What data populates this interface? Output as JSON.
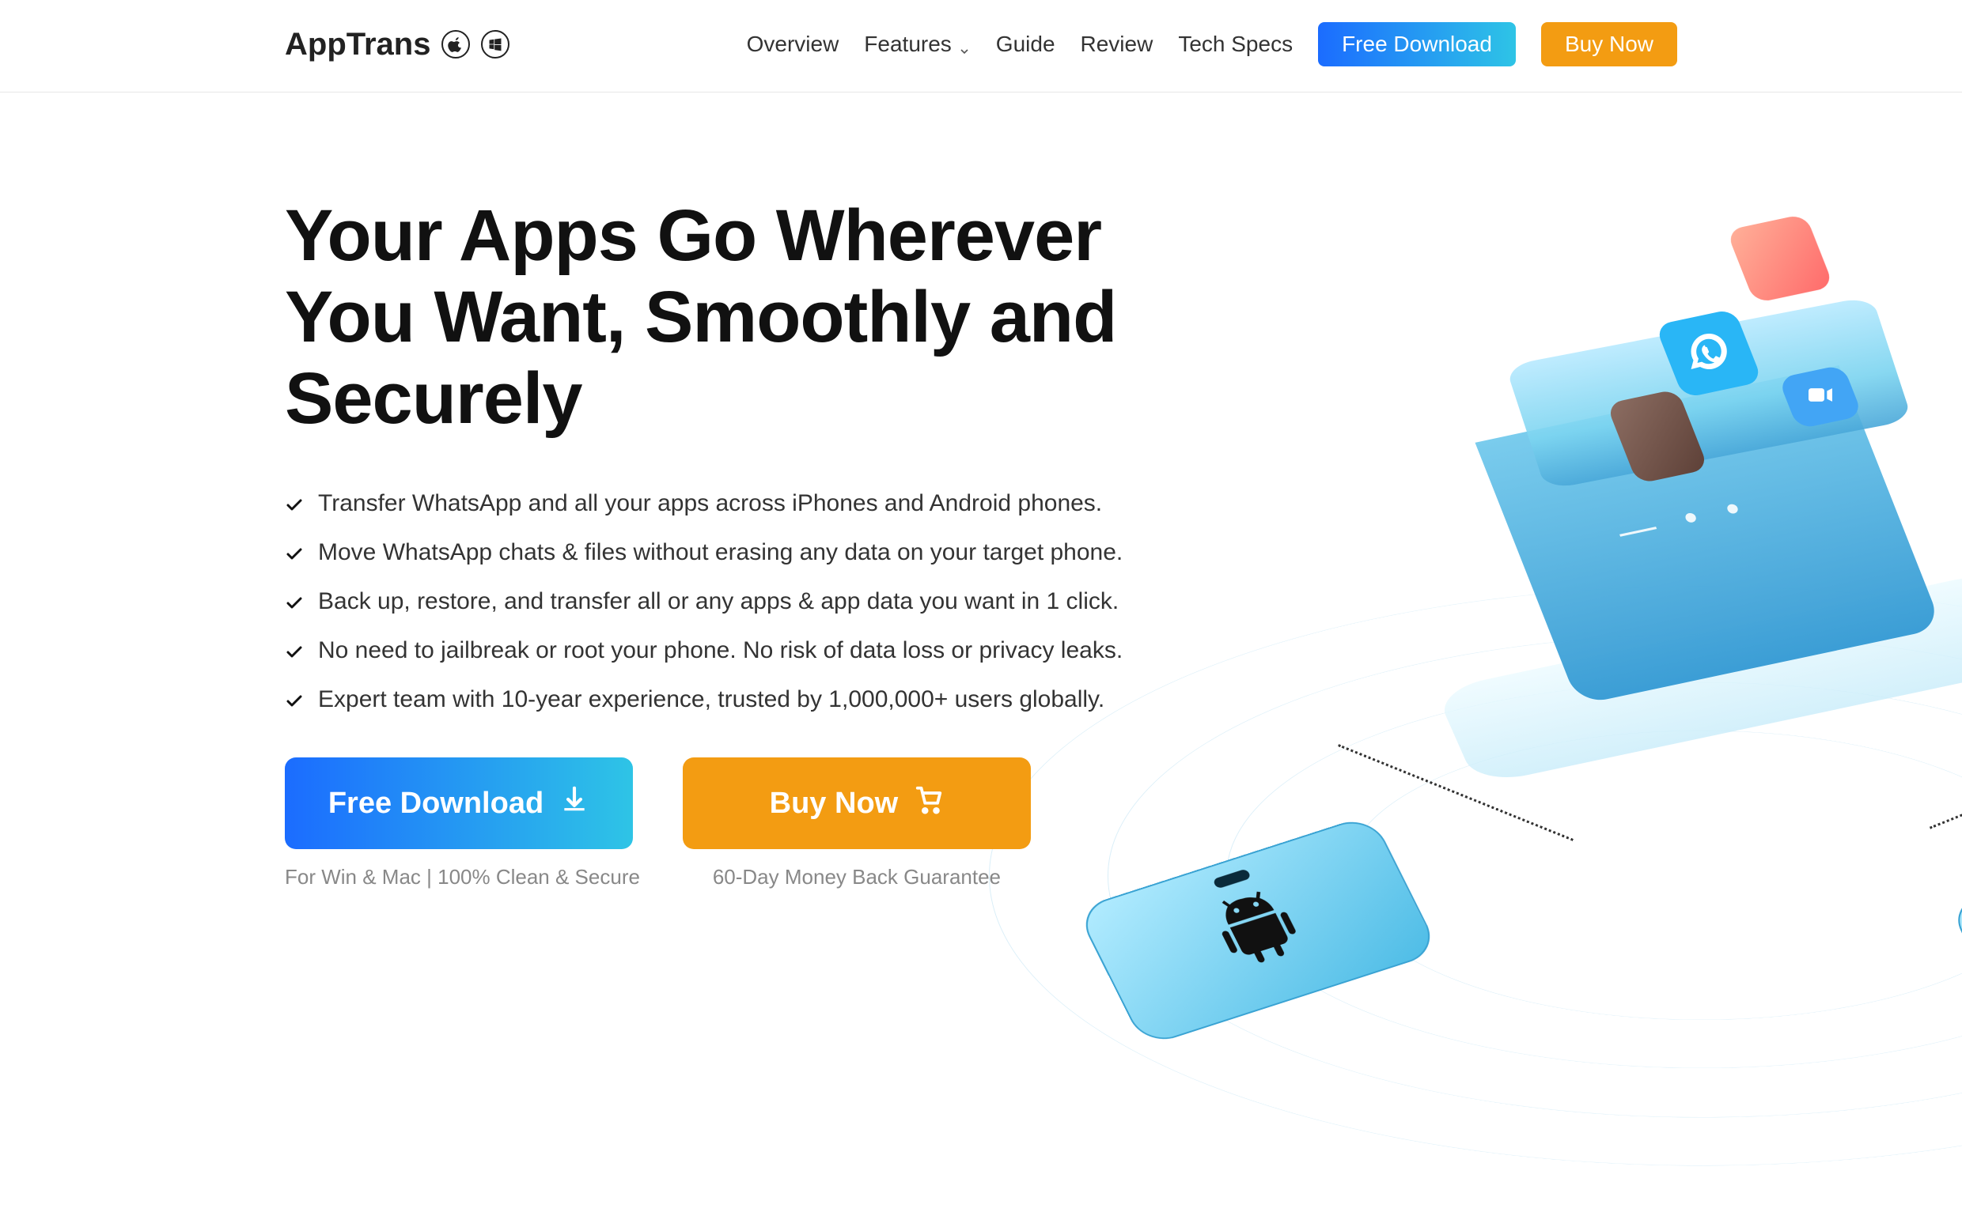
{
  "brand": {
    "name": "AppTrans"
  },
  "nav": {
    "overview": "Overview",
    "features": "Features",
    "guide": "Guide",
    "review": "Review",
    "techspecs": "Tech Specs",
    "download": "Free Download",
    "buy": "Buy Now"
  },
  "hero": {
    "title": "Your Apps Go Wherever You Want, Smoothly and Securely",
    "features": [
      "Transfer WhatsApp and all your apps across iPhones and Android phones.",
      "Move WhatsApp chats & files without erasing any data on your target phone.",
      "Back up, restore, and transfer all or any apps & app data you want in 1 click.",
      "No need to jailbreak or root your phone. No risk of data loss or privacy leaks.",
      "Expert team with 10-year experience, trusted by 1,000,000+ users globally."
    ],
    "download_label": "Free Download",
    "download_sub": "For Win & Mac | 100% Clean & Secure",
    "buy_label": "Buy Now",
    "buy_sub": "60-Day Money Back Guarantee"
  }
}
